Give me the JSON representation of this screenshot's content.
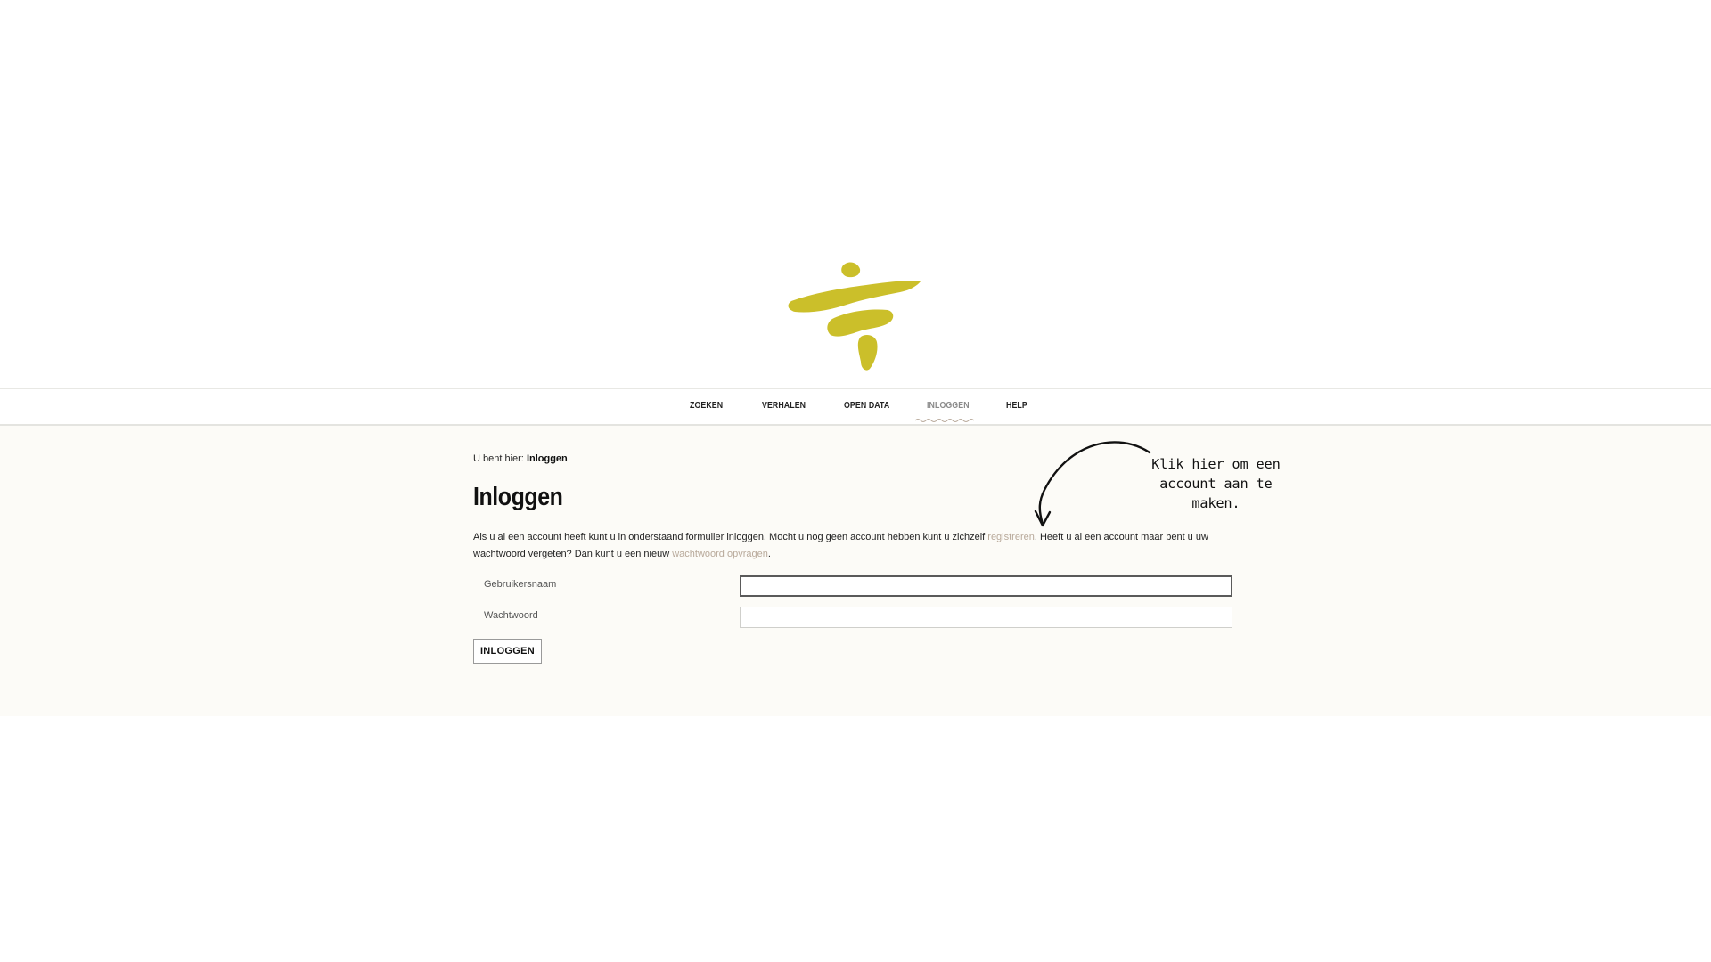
{
  "logo": {
    "icon": "brush-stroke-logo-icon",
    "color": "#cbbf2a"
  },
  "nav": {
    "items": [
      {
        "label": "ZOEKEN",
        "active": false
      },
      {
        "label": "VERHALEN",
        "active": false
      },
      {
        "label": "OPEN DATA",
        "active": false
      },
      {
        "label": "INLOGGEN",
        "active": true
      },
      {
        "label": "HELP",
        "active": false
      }
    ]
  },
  "breadcrumb": {
    "prefix": "U bent hier:",
    "current": "Inloggen"
  },
  "page": {
    "title": "Inloggen"
  },
  "intro": {
    "text1": "Als u al een account heeft kunt u in onderstaand formulier inloggen. Mocht u nog geen account hebben kunt u zichzelf ",
    "register_link": "registreren",
    "text2": ". Heeft u al een account maar bent u uw wachtwoord vergeten? Dan kunt u een nieuw ",
    "password_link": "wachtwoord opvragen",
    "text3": "."
  },
  "form": {
    "username_label": "Gebruikersnaam",
    "username_value": "",
    "password_label": "Wachtwoord",
    "password_value": "",
    "submit_label": "INLOGGEN"
  },
  "annotation": {
    "line1": "Klik hier om een",
    "line2": "account aan te maken.",
    "arrow_icon": "curved-arrow-icon"
  },
  "colors": {
    "accent": "#cbbf2a",
    "link": "#b8a99a",
    "band": "#fcfbf7"
  }
}
